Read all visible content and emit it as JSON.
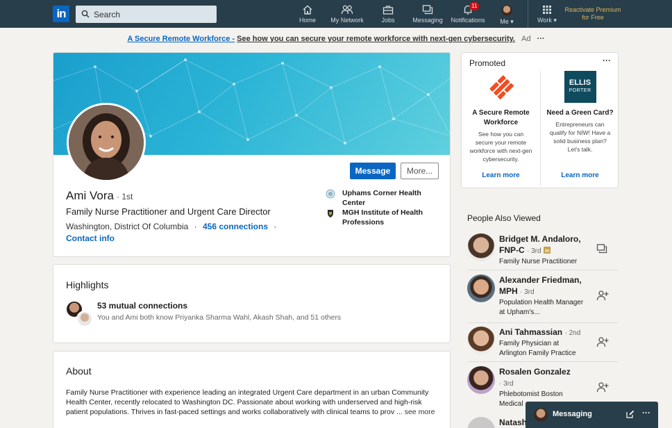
{
  "nav": {
    "logo": "in",
    "search_placeholder": "Search",
    "items": [
      {
        "label": "Home",
        "icon": "home-icon"
      },
      {
        "label": "My Network",
        "icon": "network-icon"
      },
      {
        "label": "Jobs",
        "icon": "briefcase-icon"
      },
      {
        "label": "Messaging",
        "icon": "messaging-icon"
      },
      {
        "label": "Notifications",
        "icon": "bell-icon",
        "badge": "11"
      },
      {
        "label": "Me ▾",
        "icon": "avatar"
      },
      {
        "label": "Work ▾",
        "icon": "grid-icon"
      }
    ],
    "premium": "Reactivate Premium for Free"
  },
  "ad": {
    "link": "A Secure Remote Workforce -",
    "text": "See how you can secure your remote workforce with next-gen cybersecurity.",
    "tag": "Ad",
    "more": "···"
  },
  "profile": {
    "name": "Ami Vora",
    "degree": "· 1st",
    "headline": "Family Nurse Practitioner and Urgent Care Director",
    "location": "Washington, District Of Columbia",
    "location_sep": "·",
    "connections": "456 connections",
    "connections_sep": "·",
    "contact": "Contact info",
    "message_btn": "Message",
    "more_btn": "More...",
    "education": [
      "Uphams Corner Health Center",
      "MGH Institute of Health Professions"
    ]
  },
  "highlights": {
    "title": "Highlights",
    "mutual": "53 mutual connections",
    "mutual_sub": "You and Ami both know Priyanka Sharma Wahl, Akash Shah, and 51 others"
  },
  "about": {
    "title": "About",
    "text": "Family Nurse Practitioner with experience leading an integrated Urgent Care department in an urban Community Health Center, recently relocated to Washington DC. Passionate about working with underserved and high-risk patient populations. Thrives in fast-paced settings and works collaboratively with clinical teams to prov ...",
    "see_more": "see more"
  },
  "promoted": {
    "title": "Promoted",
    "more": "···",
    "ads": [
      {
        "title": "A Secure Remote Workforce",
        "text": "See how you can secure your remote workforce with next-gen cybersecurity.",
        "cta": "Learn more"
      },
      {
        "logo_line1": "ELLIS",
        "logo_line2": "PORTER",
        "title": "Need a Green Card?",
        "text": "Entrepreneurs can qualify for NIW! Have a solid business plan? Let's talk.",
        "cta": "Learn more"
      }
    ]
  },
  "people_also_viewed": {
    "title": "People Also Viewed",
    "people": [
      {
        "name": "Bridget M. Andaloro, FNP-C",
        "degree": "· 3rd",
        "sub": "Family Nurse Practitioner",
        "action": "message-icon"
      },
      {
        "name": "Alexander Friedman, MPH",
        "degree": "· 3rd",
        "sub": "Population Health Manager at Upham's...",
        "action": "add-connection-icon"
      },
      {
        "name": "Ani Tahmassian",
        "degree": "· 2nd",
        "sub": "Family Physician at Arlington Family Practice",
        "action": "add-connection-icon"
      },
      {
        "name": "Rosalen Gonzalez",
        "degree": "· 3rd",
        "sub": "Phlebotomist Boston Medical",
        "action": "add-connection-icon"
      },
      {
        "name": "Natash",
        "degree": "",
        "sub": "",
        "action": ""
      }
    ]
  },
  "messaging": {
    "label": "Messaging",
    "more": "···"
  },
  "colors": {
    "nav_bg": "#283e4a",
    "brand_blue": "#0a66c2",
    "premium_gold": "#d9b35a",
    "badge_red": "#cc1016"
  }
}
